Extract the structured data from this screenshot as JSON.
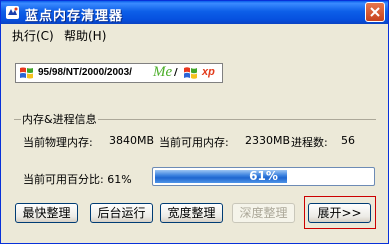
{
  "window": {
    "title": "蓝点内存清理器"
  },
  "menu": {
    "items": [
      "执行(C)",
      "帮助(H)"
    ]
  },
  "banner": {
    "versions": "95/98/NT/2000/2003/",
    "me": "Me",
    "slash": "/",
    "xp": "xp"
  },
  "info": {
    "group_title": "内存&进程信息",
    "physical_label": "当前物理内存:",
    "physical_value": "3840MB",
    "available_label": "当前可用内存:",
    "available_value": "2330MB",
    "process_label": "进程数:",
    "process_value": "56",
    "percent_label": "当前可用百分比: 61%",
    "progress_percent": 61,
    "progress_text": "61%"
  },
  "buttons": {
    "fastest": "最快整理",
    "background": "后台运行",
    "broad": "宽度整理",
    "deep": "深度整理",
    "expand": "展开>>"
  },
  "colors": {
    "titlebar": "#0650DF",
    "close": "#C6421E",
    "progress": "#1E66D0",
    "focus": "#CC0000"
  }
}
